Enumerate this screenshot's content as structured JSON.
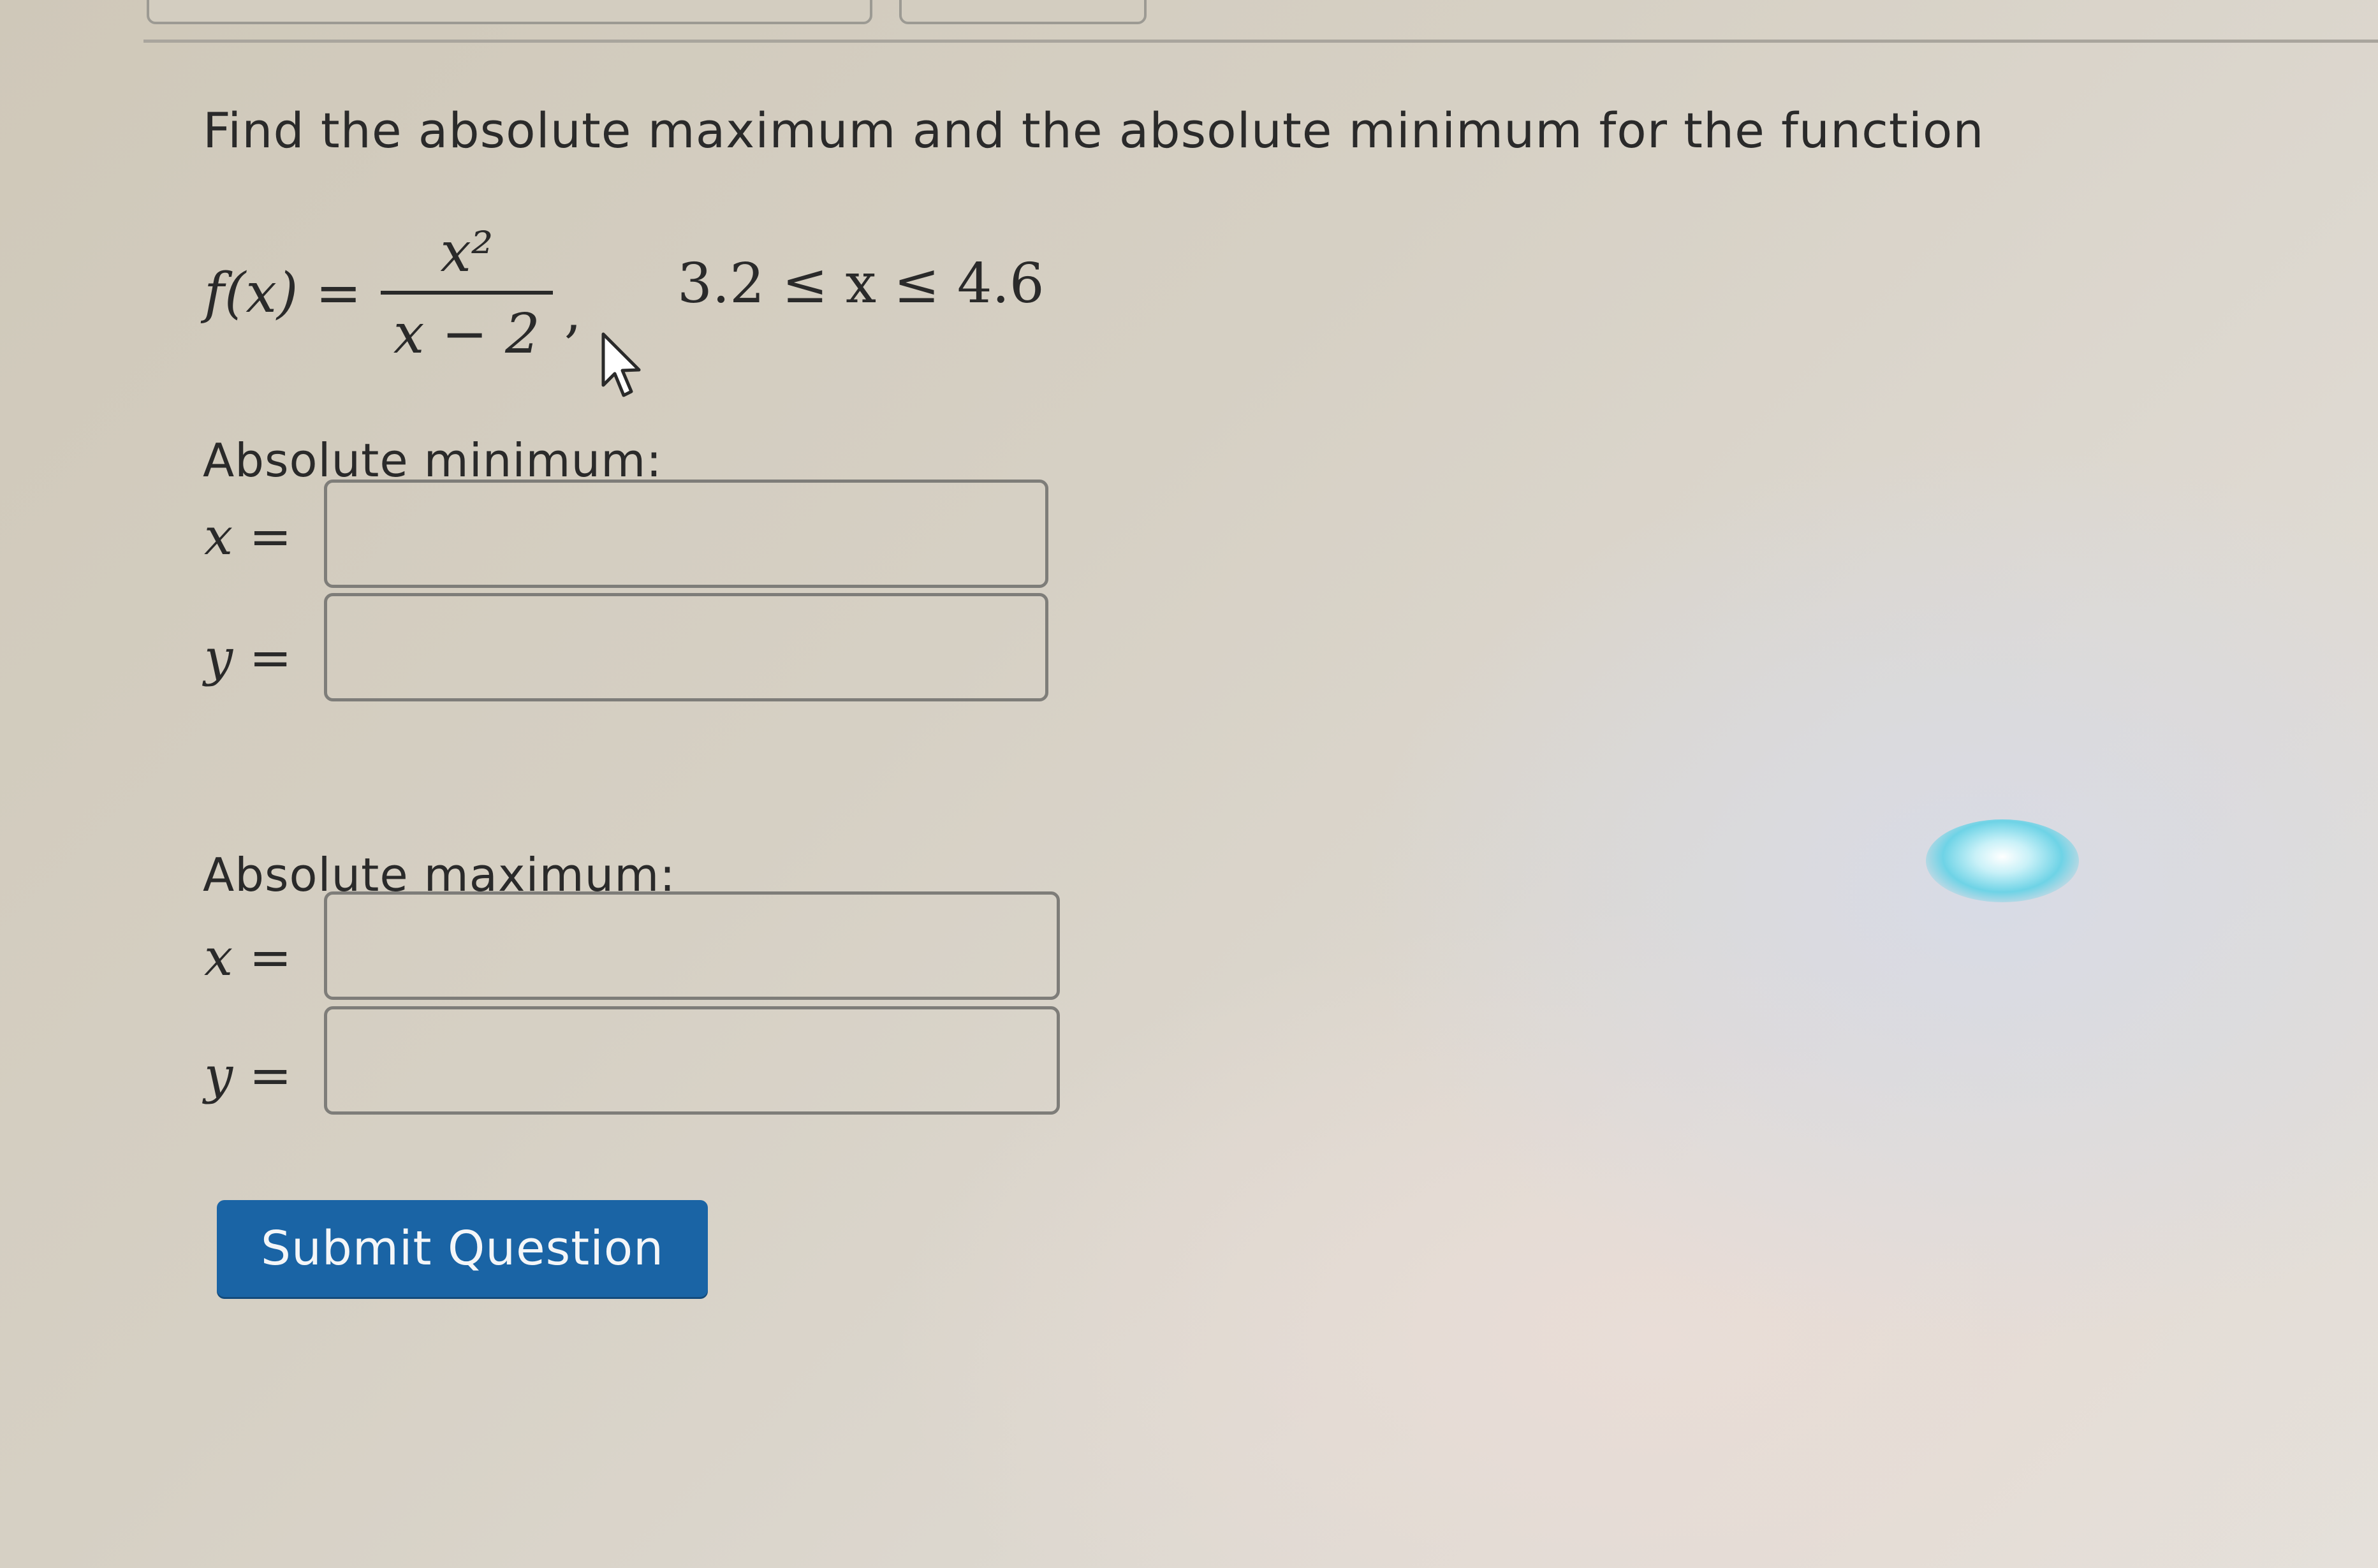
{
  "question": {
    "prompt": "Find the absolute maximum and the absolute minimum for the function",
    "function_lhs": "f(x) =",
    "numerator": "x²",
    "denominator": "x − 2",
    "separator": ",",
    "domain": "3.2 ≤ x ≤ 4.6"
  },
  "minimum": {
    "label": "Absolute minimum:",
    "x_label": "x =",
    "y_label": "y =",
    "x_value": "",
    "y_value": ""
  },
  "maximum": {
    "label": "Absolute maximum:",
    "x_label": "x =",
    "y_label": "y =",
    "x_value": "",
    "y_value": ""
  },
  "submit": {
    "label": "Submit Question",
    "color": "#1a64a5"
  },
  "icons": {
    "cursor": "mouse-pointer-icon"
  }
}
